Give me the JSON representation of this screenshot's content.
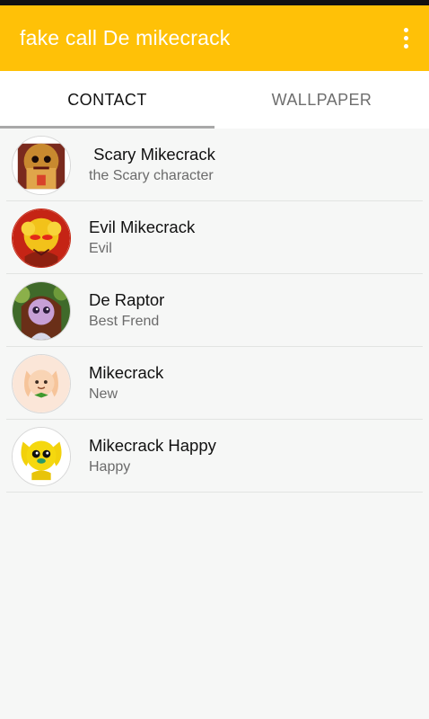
{
  "app_bar": {
    "title": "fake call De mikecrack",
    "menu_icon": "more-vert-icon",
    "color": "#ffc107"
  },
  "tabs": [
    {
      "label": "CONTACT",
      "active": true
    },
    {
      "label": "WALLPAPER",
      "active": false
    }
  ],
  "contacts": [
    {
      "name": " Scary Mikecrack",
      "subtitle": "the Scary character",
      "avatar": "scary-mikecrack-avatar-icon"
    },
    {
      "name": "Evil Mikecrack",
      "subtitle": "Evil",
      "avatar": "evil-mikecrack-avatar-icon"
    },
    {
      "name": "De Raptor",
      "subtitle": "Best Frend",
      "avatar": "raptor-avatar-icon"
    },
    {
      "name": "Mikecrack",
      "subtitle": "New",
      "avatar": "mikecrack-avatar-icon"
    },
    {
      "name": "Mikecrack Happy",
      "subtitle": "Happy",
      "avatar": "happy-mikecrack-avatar-icon"
    }
  ]
}
